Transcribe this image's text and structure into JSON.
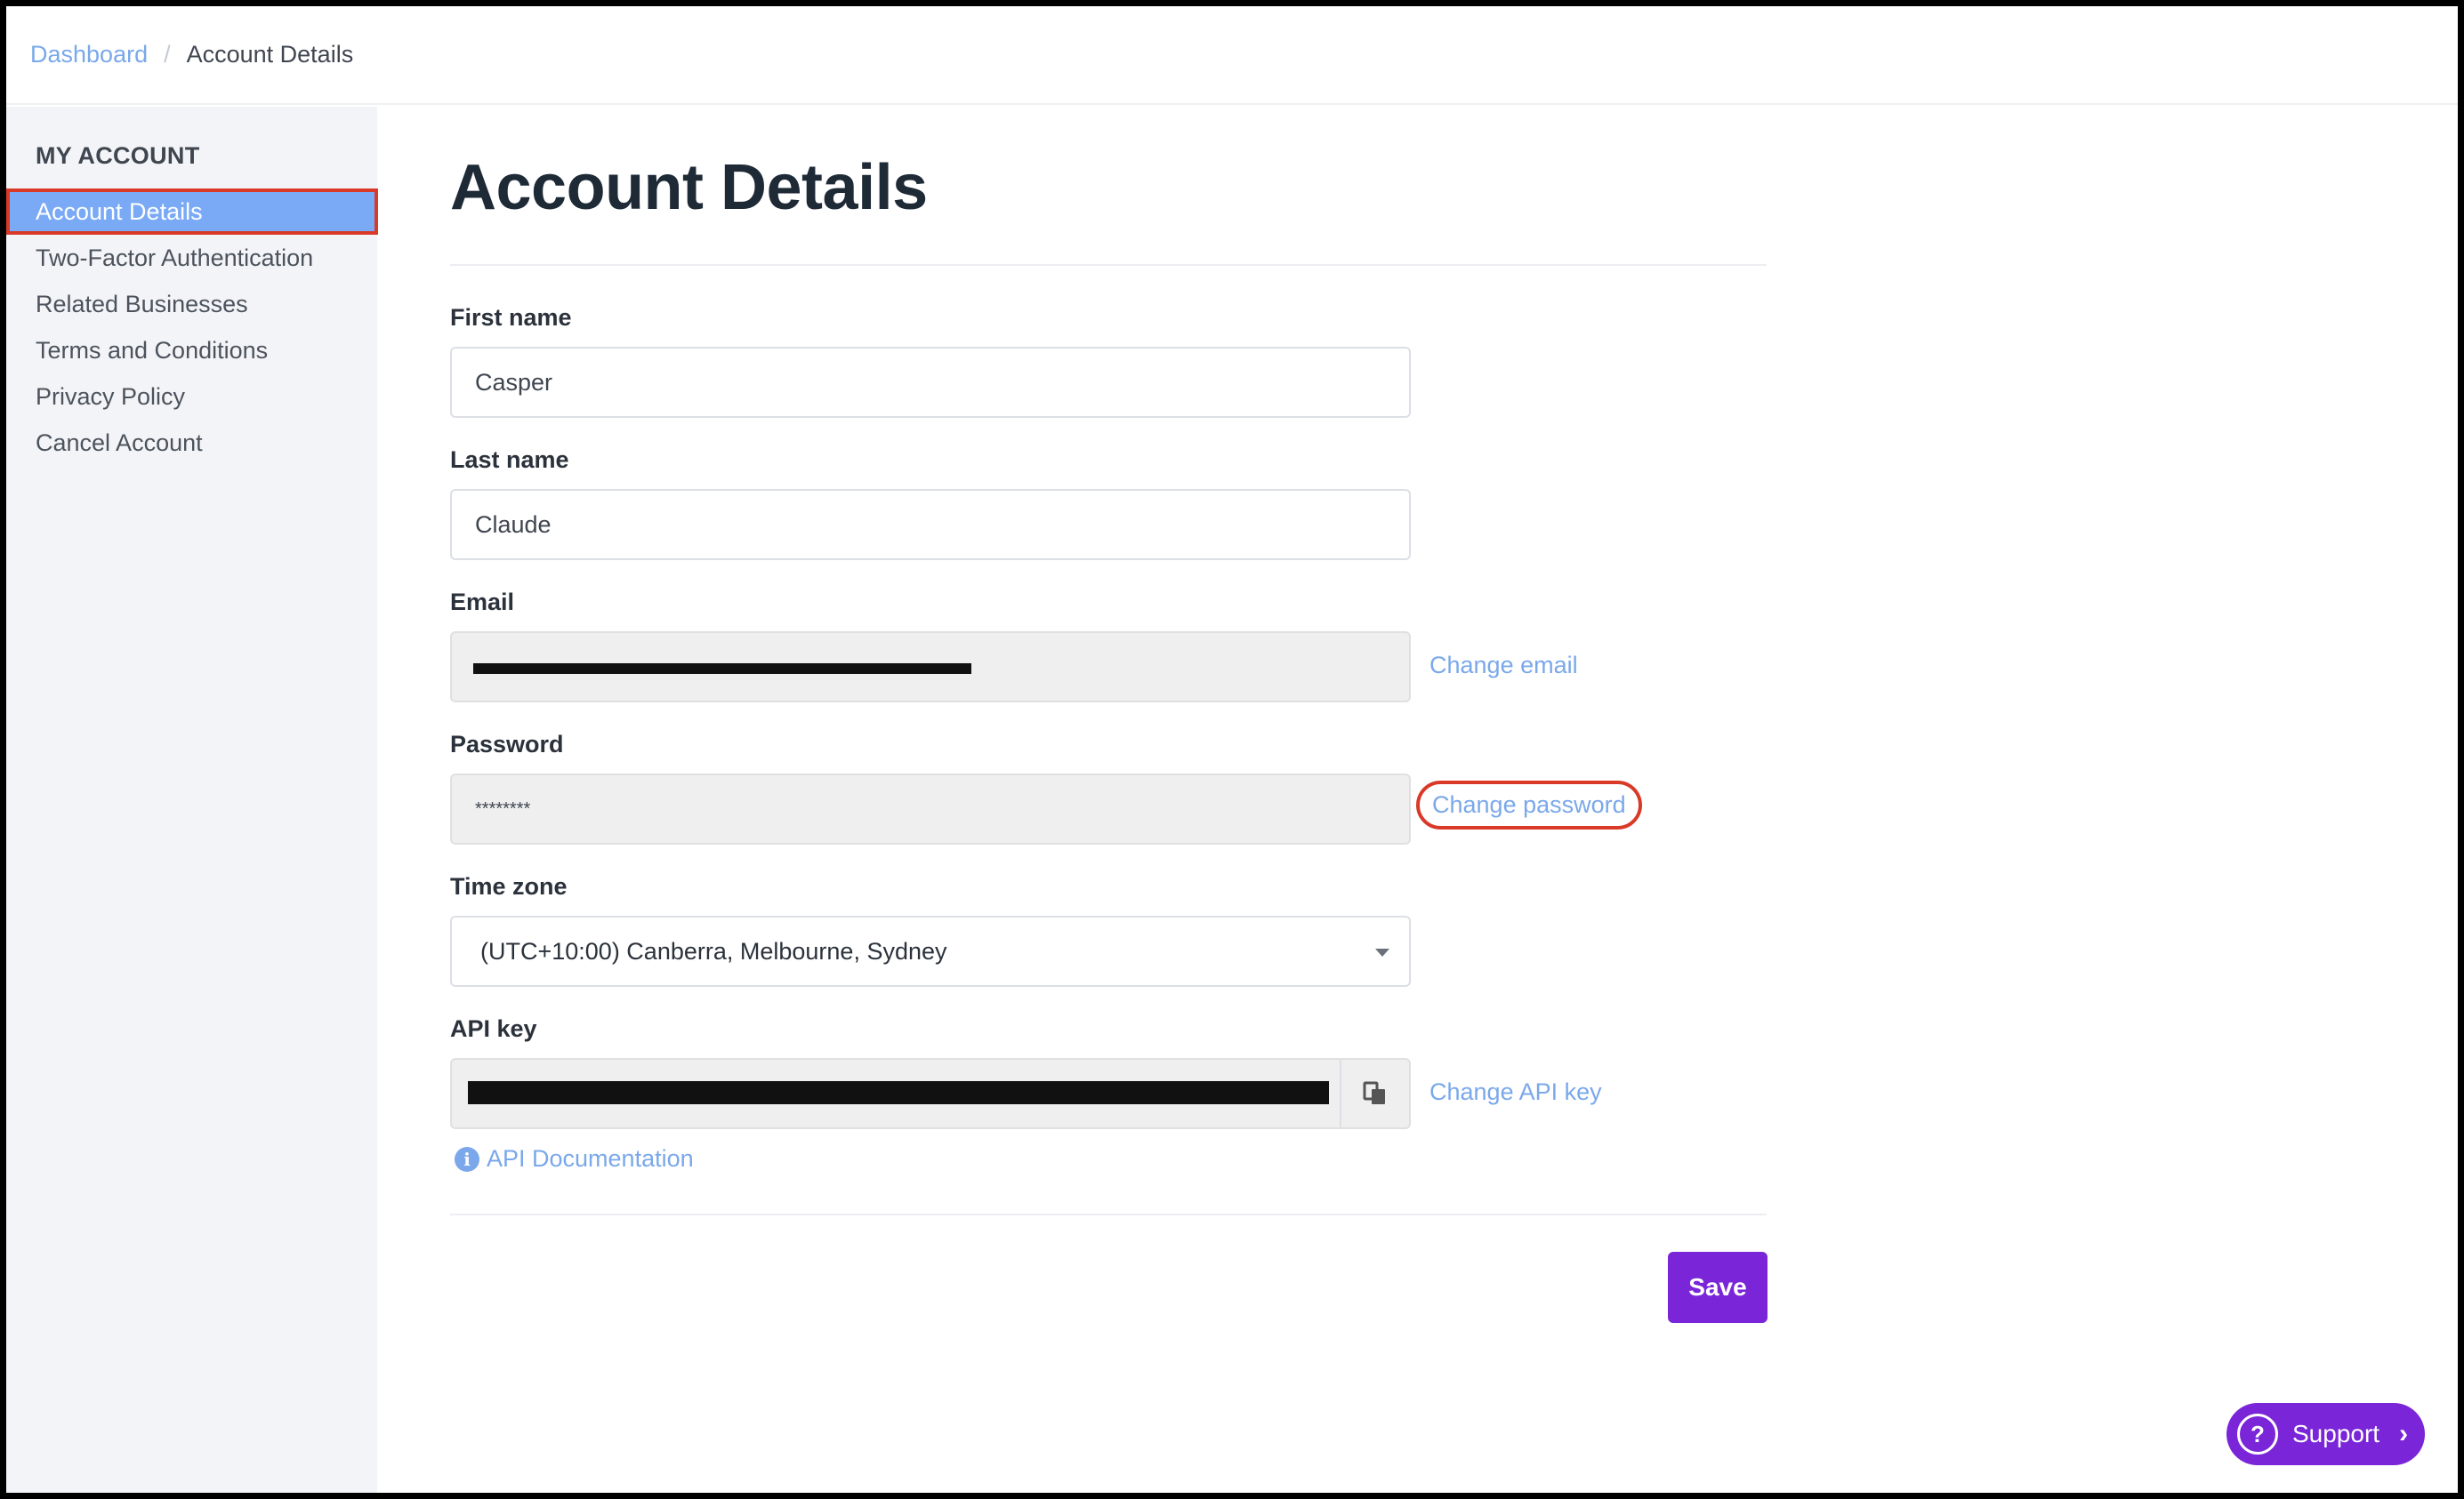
{
  "breadcrumb": {
    "items": [
      {
        "label": "Dashboard"
      },
      {
        "label": "Account Details"
      }
    ],
    "separator": "/"
  },
  "sidebar": {
    "heading": "MY ACCOUNT",
    "items": [
      {
        "label": "Account Details",
        "active": true
      },
      {
        "label": "Two-Factor Authentication"
      },
      {
        "label": "Related Businesses"
      },
      {
        "label": "Terms and Conditions"
      },
      {
        "label": "Privacy Policy"
      },
      {
        "label": "Cancel Account"
      }
    ]
  },
  "main": {
    "title": "Account Details",
    "first_name": {
      "label": "First name",
      "value": "Casper"
    },
    "last_name": {
      "label": "Last name",
      "value": "Claude"
    },
    "email": {
      "label": "Email",
      "change_link": "Change email"
    },
    "password": {
      "label": "Password",
      "value": "********",
      "change_link": "Change password"
    },
    "time_zone": {
      "label": "Time zone",
      "value": "(UTC+10:00) Canberra, Melbourne, Sydney"
    },
    "api_key": {
      "label": "API key",
      "change_link": "Change API key",
      "doc_link": "API Documentation"
    },
    "save_label": "Save"
  },
  "support": {
    "label": "Support"
  },
  "icons": {
    "copy": "copy-icon",
    "info": "info-icon",
    "help": "question-circle-icon",
    "chevron": "chevron-right-icon",
    "dropdown": "caret-down-icon"
  },
  "colors": {
    "link": "#7aa8ea",
    "accent": "#7a26d8",
    "active_nav": "#7aaaf6",
    "highlight": "#d93a28"
  }
}
